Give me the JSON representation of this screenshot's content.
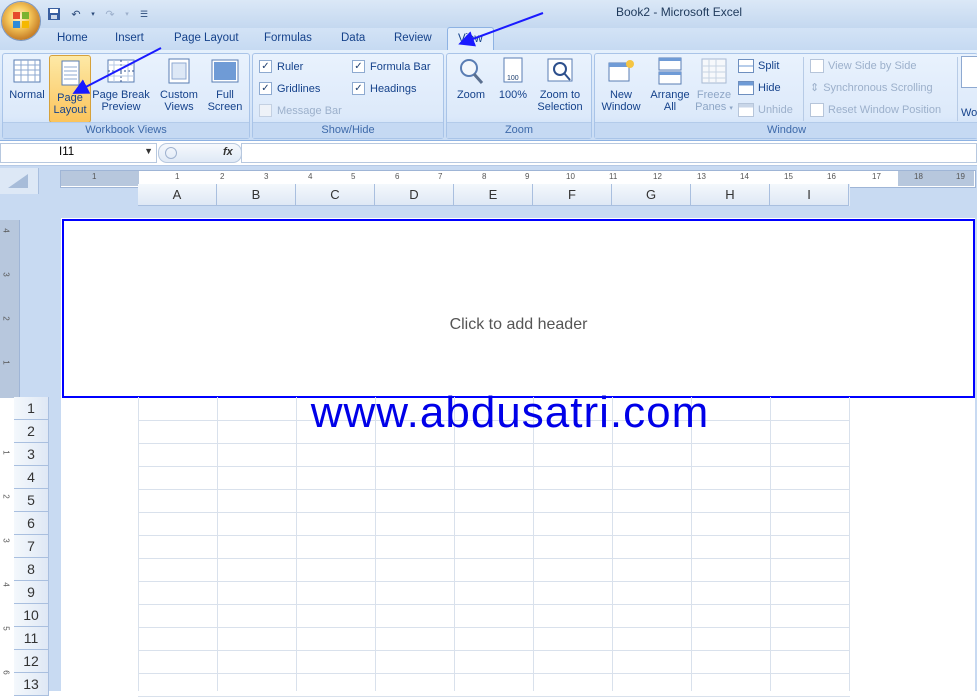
{
  "window": {
    "title": "Book2 - Microsoft Excel"
  },
  "tabs": [
    {
      "label": "Home"
    },
    {
      "label": "Insert"
    },
    {
      "label": "Page Layout"
    },
    {
      "label": "Formulas"
    },
    {
      "label": "Data"
    },
    {
      "label": "Review"
    },
    {
      "label": "View",
      "active": true
    }
  ],
  "ribbon": {
    "workbook_views": {
      "label": "Workbook Views",
      "normal": "Normal",
      "page_layout": [
        "Page",
        "Layout"
      ],
      "page_break": [
        "Page Break",
        "Preview"
      ],
      "custom_views": [
        "Custom",
        "Views"
      ],
      "full_screen": [
        "Full",
        "Screen"
      ]
    },
    "show_hide": {
      "label": "Show/Hide",
      "ruler": "Ruler",
      "formula_bar": "Formula Bar",
      "gridlines": "Gridlines",
      "headings": "Headings",
      "message_bar": "Message Bar"
    },
    "zoom": {
      "label": "Zoom",
      "zoom": "Zoom",
      "hundred": "100%",
      "zoom_to_selection": [
        "Zoom to",
        "Selection"
      ]
    },
    "window": {
      "label": "Window",
      "new_window": [
        "New",
        "Window"
      ],
      "arrange_all": [
        "Arrange",
        "All"
      ],
      "freeze_panes": [
        "Freeze",
        "Panes"
      ],
      "split": "Split",
      "hide": "Hide",
      "unhide": "Unhide",
      "view_side_by_side": "View Side by Side",
      "sync_scrolling": "Synchronous Scrolling",
      "reset_position": "Reset Window Position",
      "overflow": "Wo"
    }
  },
  "formula_bar": {
    "name_box": "I11",
    "fx": "fx",
    "value": ""
  },
  "ruler": {
    "h_numbers": [
      "1",
      "1",
      "2",
      "3",
      "4",
      "5",
      "6",
      "7",
      "8",
      "9",
      "10",
      "11",
      "12",
      "13",
      "14",
      "15",
      "16",
      "17",
      "18",
      "19"
    ],
    "v_numbers": [
      "4",
      "3",
      "2",
      "1",
      "1",
      "2",
      "3",
      "4",
      "5",
      "6"
    ]
  },
  "columns": [
    "A",
    "B",
    "C",
    "D",
    "E",
    "F",
    "G",
    "H",
    "I"
  ],
  "rows": [
    "1",
    "2",
    "3",
    "4",
    "5",
    "6",
    "7",
    "8",
    "9",
    "10",
    "11",
    "12",
    "13"
  ],
  "header_placeholder": "Click to add header",
  "watermark": "www.abdusatri.com",
  "colors": {
    "accent": "#0000ff",
    "arrow": "#1a1aff"
  }
}
